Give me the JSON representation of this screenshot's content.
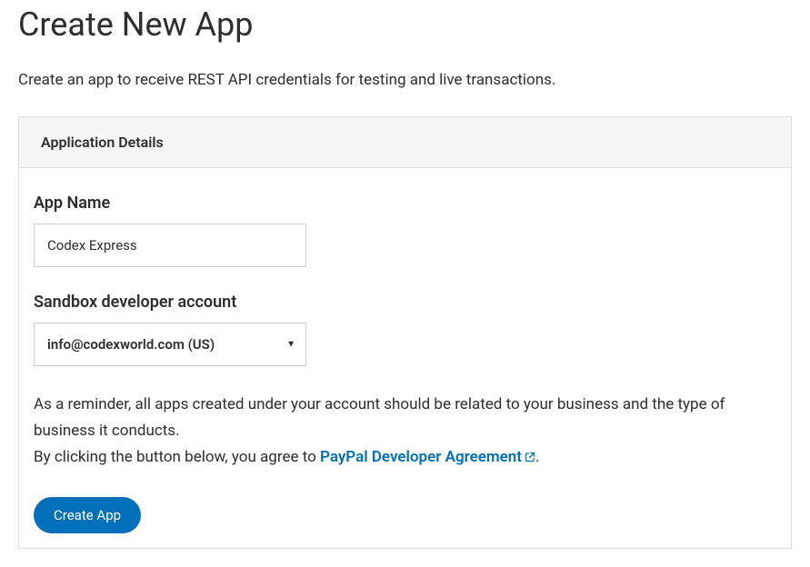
{
  "page": {
    "title": "Create New App",
    "subtitle": "Create an app to receive REST API credentials for testing and live transactions."
  },
  "panel": {
    "header": "Application Details"
  },
  "form": {
    "appName": {
      "label": "App Name",
      "value": "Codex Express"
    },
    "sandboxAccount": {
      "label": "Sandbox developer account",
      "selected": "info@codexworld.com (US)"
    },
    "reminder": "As a reminder, all apps created under your account should be related to your business and the type of business it conducts.",
    "agreementPrefix": "By clicking the button below, you agree to ",
    "agreementLink": "PayPal Developer Agreement",
    "agreementSuffix": ".",
    "submitLabel": "Create App"
  }
}
